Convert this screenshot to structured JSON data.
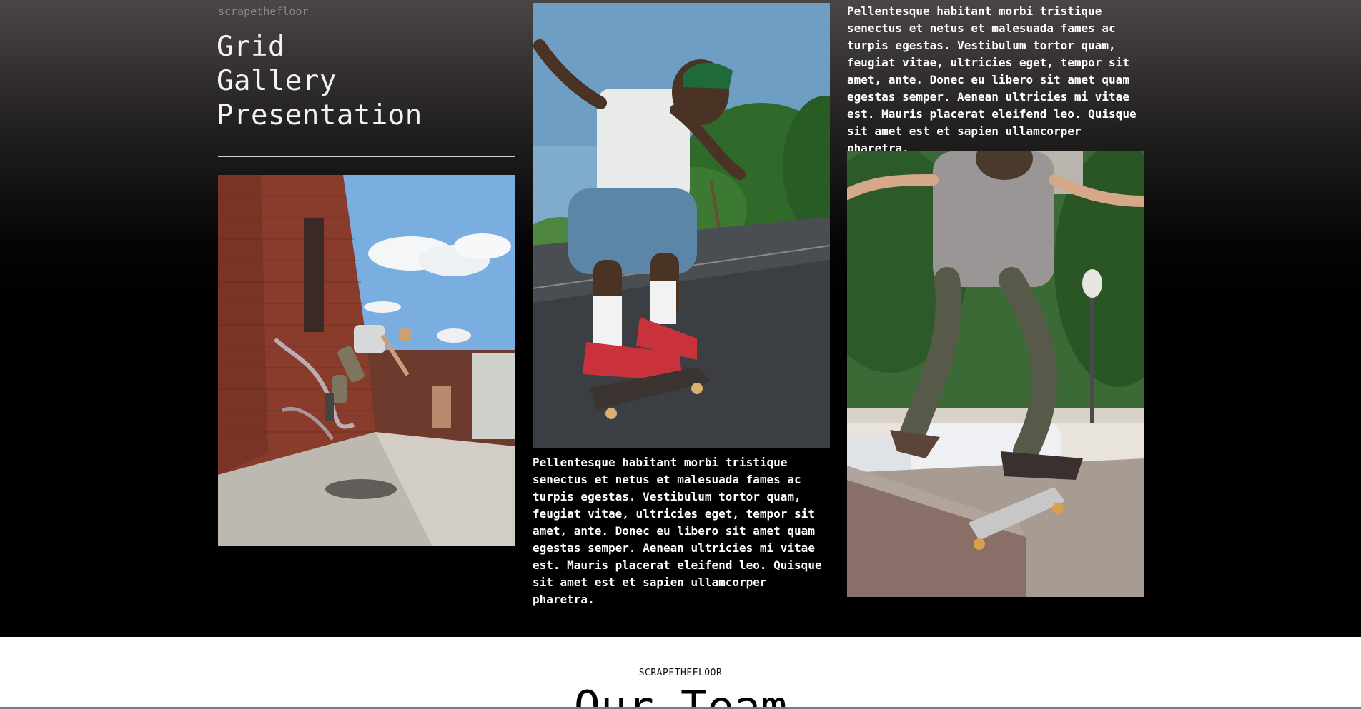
{
  "header": {
    "brand": "scrapethefloor",
    "title": "Grid\nGallery\nPresentation"
  },
  "gallery": {
    "photos": [
      {
        "icon": "skateboarder-wallride-photo"
      },
      {
        "icon": "skateboarder-green-cap-photo"
      },
      {
        "icon": "skateboarder-ollie-photo"
      }
    ],
    "paragraph_1": "Pellentesque habitant morbi tristique senectus et netus et malesuada fames ac turpis egestas. Vestibulum tortor quam, feugiat vitae, ultricies eget, tempor sit amet, ante. Donec eu libero sit amet quam egestas semper. Aenean ultricies mi vitae est. Mauris placerat eleifend leo. Quisque sit amet est et sapien ullamcorper pharetra.",
    "paragraph_2": "Pellentesque habitant morbi tristique senectus et netus et malesuada fames ac turpis egestas. Vestibulum tortor quam, feugiat vitae, ultricies eget, tempor sit amet, ante. Donec eu libero sit amet quam egestas semper. Aenean ultricies mi vitae est. Mauris placerat eleifend leo. Quisque sit amet est et sapien ullamcorper pharetra."
  },
  "team": {
    "eyebrow": "SCRAPETHEFLOOR",
    "title": "Our Team"
  },
  "colors": {
    "background": "#000000",
    "text": "#ffffff",
    "muted": "#8a8787",
    "section_bg": "#ffffff"
  }
}
